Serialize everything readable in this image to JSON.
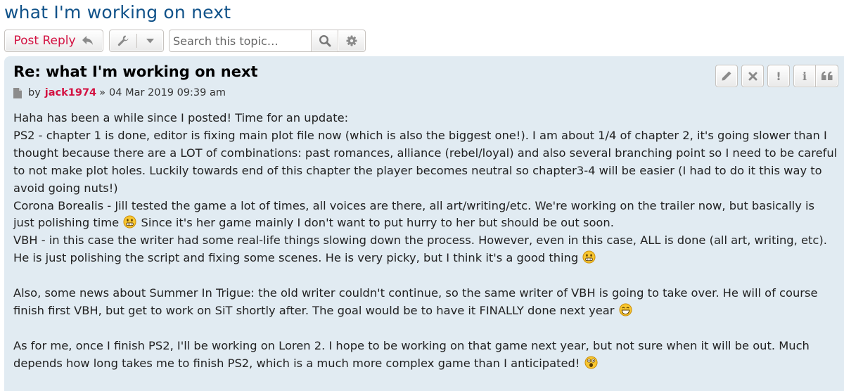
{
  "topic": {
    "title": "what I'm working on next"
  },
  "action_bar": {
    "post_reply_label": "Post Reply",
    "post_reply_icon": "reply-arrow-icon",
    "tools_icon": "wrench-icon",
    "dropdown_icon": "caret-down-icon",
    "search_placeholder": "Search this topic…",
    "search_icon": "magnifier-icon",
    "advanced_search_icon": "gear-icon"
  },
  "post": {
    "title": "Re: what I'm working on next",
    "by": "by",
    "author": "jack1974",
    "separator": "»",
    "date": "04 Mar 2019 09:39 am",
    "tools": [
      {
        "name": "edit",
        "icon": "pencil-icon"
      },
      {
        "name": "delete",
        "icon": "x-icon"
      },
      {
        "name": "report",
        "icon": "exclamation-icon",
        "glyph": "!"
      },
      {
        "name": "info",
        "icon": "info-icon",
        "glyph": "i"
      },
      {
        "name": "quote",
        "icon": "quote-icon"
      }
    ],
    "paragraphs": {
      "p1_l1": "Haha has been a while since I posted! Time for an update:",
      "p1_l2": "PS2 - chapter 1 is done, editor is fixing main plot file now (which is also the biggest one!). I am about 1/4 of chapter 2, it's going slower than I thought because there are a LOT of combinations: past romances, alliance (rebel/loyal) and also several branching point so I need to be careful to not make plot holes. Luckily towards end of this chapter the player becomes neutral so chapter3-4 will be easier (I had to do it this way to avoid going nuts!)",
      "p1_l3a": "Corona Borealis - Jill tested the game a lot of times, all voices are there, all art/writing/etc. We're working on the trailer now, but basically is just polishing time",
      "p1_l3b": "Since it's her game mainly I don't want to put hurry to her but should be out soon.",
      "p1_l4": "VBH - in this case the writer had some real-life things slowing down the process. However, even in this case, ALL is done (all art, writing, etc). He is just polishing the script and fixing some scenes. He is very picky, but I think it's a good thing",
      "p2": "Also, some news about Summer In Trigue: the old writer couldn't continue, so the same writer of VBH is going to take over. He will of course finish first VBH, but get to work on SiT shortly after. The goal would be to have it FINALLY done next year",
      "p3": "As for me, once I finish PS2, I'll be working on Loren 2. I hope to be working on that game next year, but not sure when it will be out. Much depends how long takes me to finish PS2, which is a much more complex game than I anticipated!"
    },
    "smilies": [
      "smiley-nervous-icon",
      "smiley-nervous-icon",
      "smiley-grin-icon",
      "smiley-shocked-icon"
    ]
  },
  "colors": {
    "title_blue": "#105289",
    "accent_red": "#d31141",
    "post_bg": "#e1ebf2"
  }
}
